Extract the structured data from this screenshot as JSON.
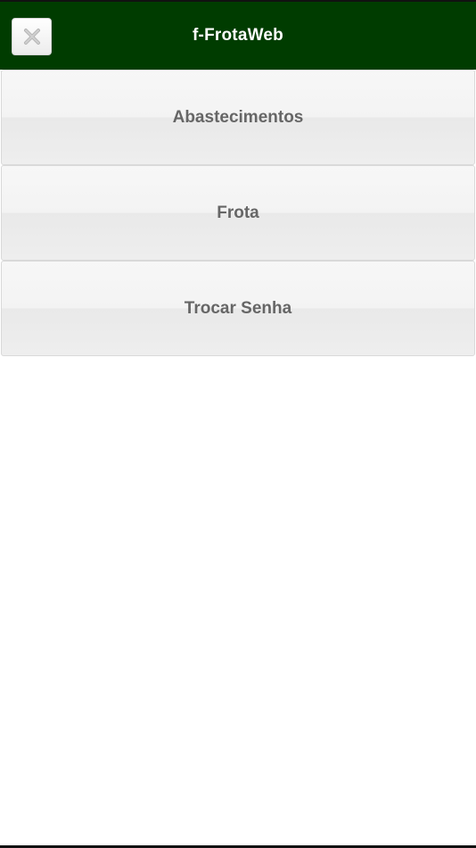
{
  "header": {
    "title": "f-FrotaWeb",
    "close_icon": "close-icon"
  },
  "menu": {
    "items": [
      {
        "label": "Abastecimentos"
      },
      {
        "label": "Frota"
      },
      {
        "label": "Trocar Senha"
      }
    ]
  },
  "colors": {
    "header_bg": "#003c00",
    "label_text": "#666666"
  }
}
